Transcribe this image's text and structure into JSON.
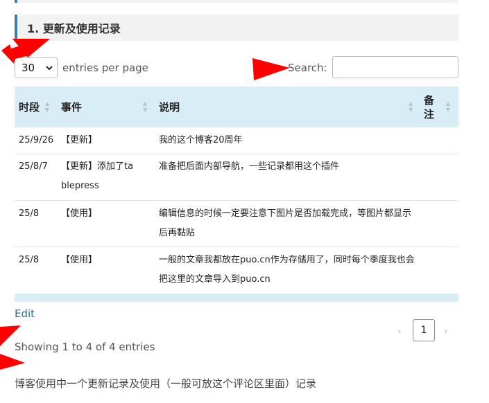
{
  "section": {
    "title": "1. 更新及使用记录"
  },
  "controls": {
    "length_value": "30",
    "length_label": "entries per page",
    "search_label": "Search:",
    "search_value": ""
  },
  "table": {
    "headers": [
      "时段",
      "事件",
      "说明",
      "备\n注"
    ],
    "rows": [
      {
        "period": "25/9/26",
        "event": "【更新】",
        "desc": "我的这个博客20周年",
        "note": ""
      },
      {
        "period": "25/8/7",
        "event": "【更新】添加了tablepress",
        "desc": "准备把后面内部导航，一些记录都用这个插件",
        "note": ""
      },
      {
        "period": "25/8",
        "event": "【使用】",
        "desc": "编辑信息的时候一定要注意下图片是否加载完成，等图片都显示后再黏贴",
        "note": ""
      },
      {
        "period": "25/8",
        "event": "【使用】",
        "desc": "一般的文章我都放在puo.cn作为存储用了，同时每个季度我也会把这里的文章导入到puo.cn",
        "note": ""
      }
    ]
  },
  "footer": {
    "edit_label": "Edit",
    "info": "Showing 1 to 4 of 4 entries",
    "page": "1",
    "prev": "‹",
    "next": "›"
  },
  "caption": "博客使用中一个更新记录及使用（一般可放这个评论区里面）记录",
  "colors": {
    "accent": "#3d7ea6",
    "header_bg": "#d9edf7",
    "link": "#2a6e96",
    "arrow": "#ff0000"
  }
}
